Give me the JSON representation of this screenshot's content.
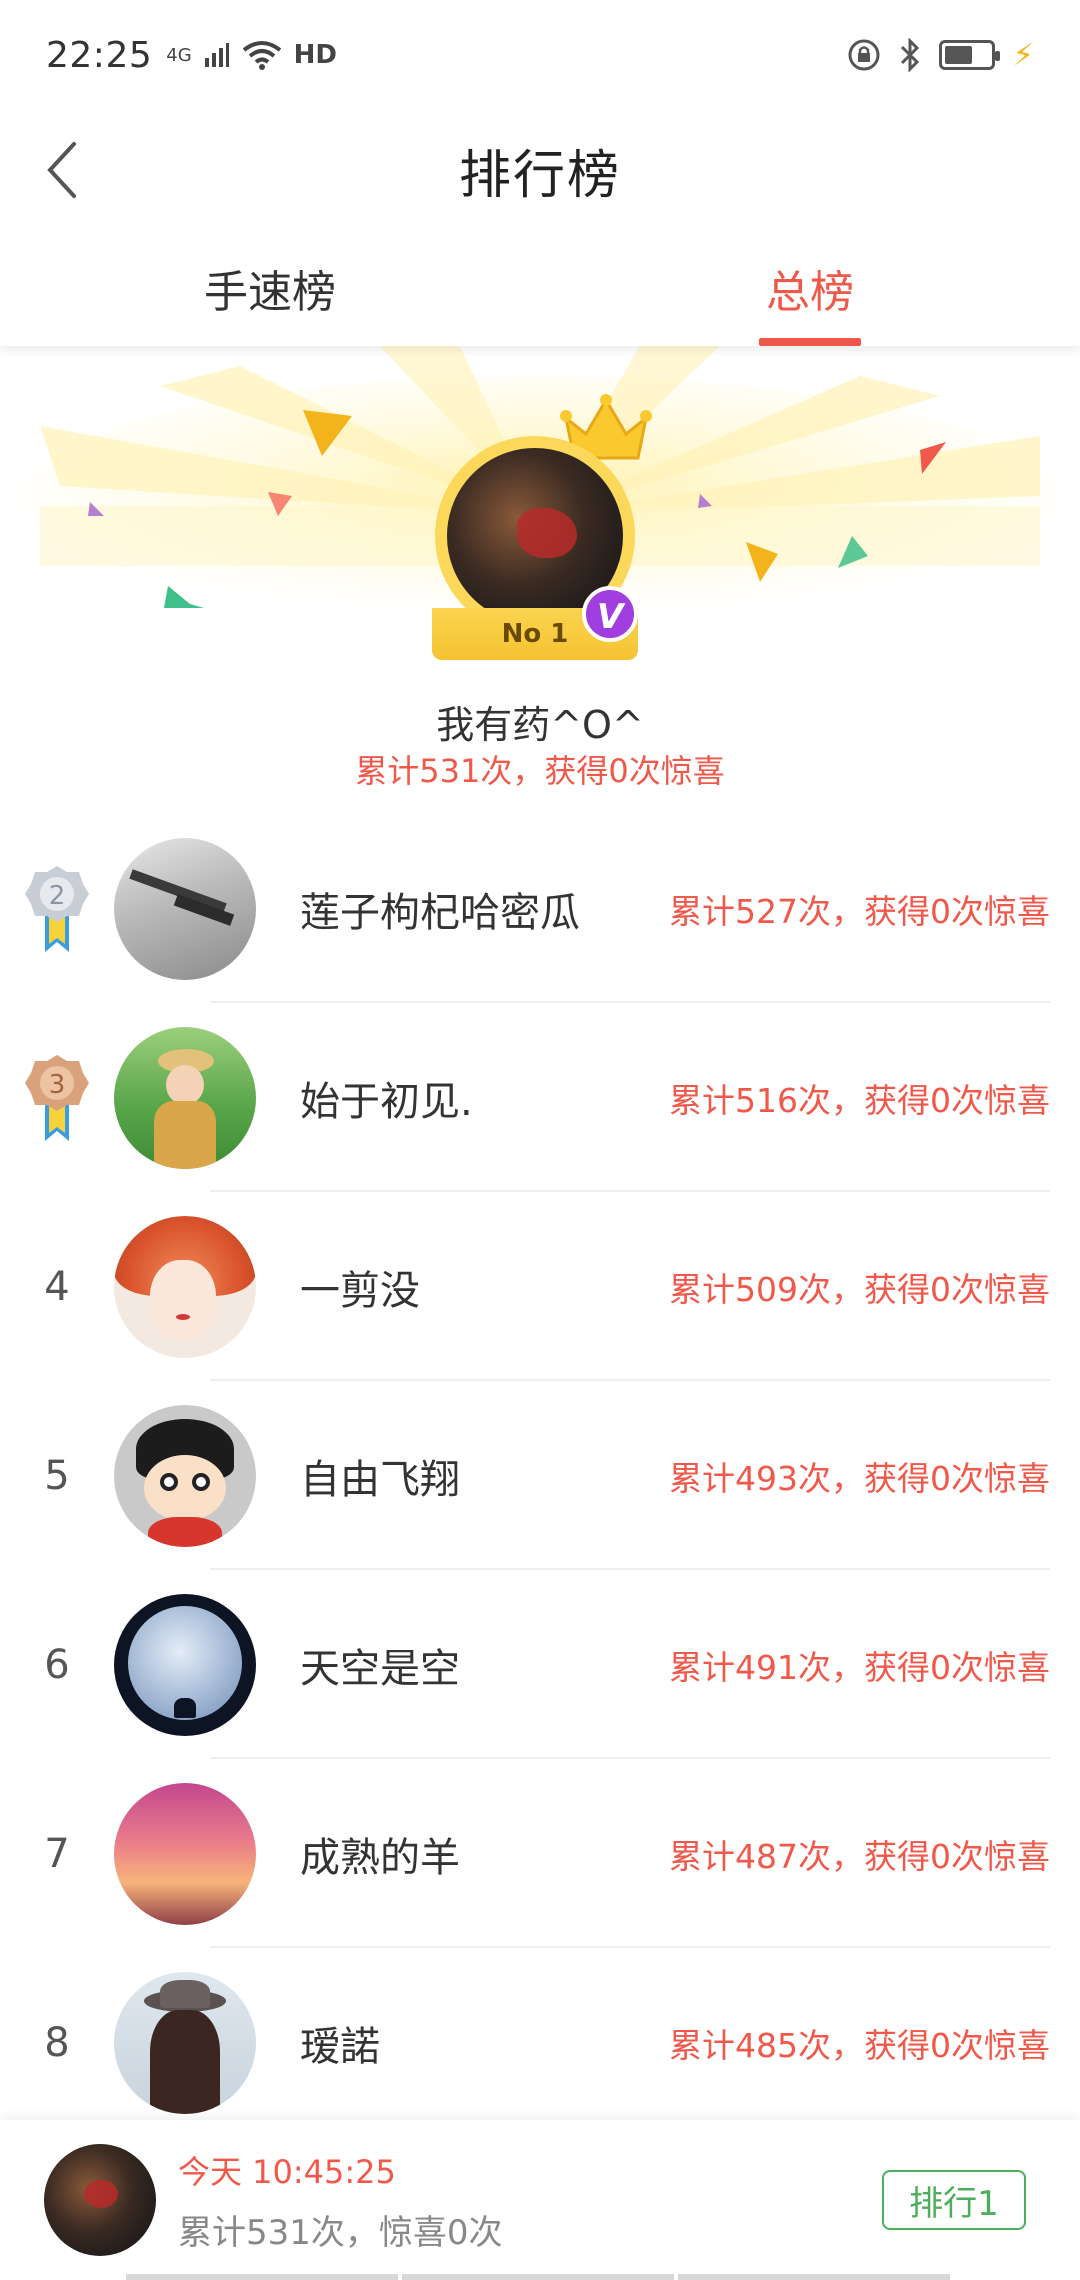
{
  "status_bar": {
    "time": "22:25",
    "network": "4G",
    "hd": "HD"
  },
  "header": {
    "title": "排行榜"
  },
  "tabs": [
    {
      "label": "手速榜",
      "active": false
    },
    {
      "label": "总榜",
      "active": true
    }
  ],
  "champion": {
    "badge": "No 1",
    "verified": "V",
    "name": "我有药^O^",
    "stat": "累计531次，获得0次惊喜"
  },
  "ranking": [
    {
      "rank": "2",
      "name": "莲子枸杞哈密瓜",
      "stat": "累计527次，获得0次惊喜"
    },
    {
      "rank": "3",
      "name": "始于初见.",
      "stat": "累计516次，获得0次惊喜"
    },
    {
      "rank": "4",
      "name": "一剪没",
      "stat": "累计509次，获得0次惊喜"
    },
    {
      "rank": "5",
      "name": "自由飞翔",
      "stat": "累计493次，获得0次惊喜"
    },
    {
      "rank": "6",
      "name": "天空是空",
      "stat": "累计491次，获得0次惊喜"
    },
    {
      "rank": "7",
      "name": "成熟的羊",
      "stat": "累计487次，获得0次惊喜"
    },
    {
      "rank": "8",
      "name": "瑷諾",
      "stat": "累计485次，获得0次惊喜"
    }
  ],
  "me": {
    "time": "今天 10:45:25",
    "stat": "累计531次，惊喜0次",
    "rank_button": "排行1"
  },
  "colors": {
    "accent": "#f0584a",
    "gold": "#fbd75a",
    "green": "#4cae5a"
  }
}
